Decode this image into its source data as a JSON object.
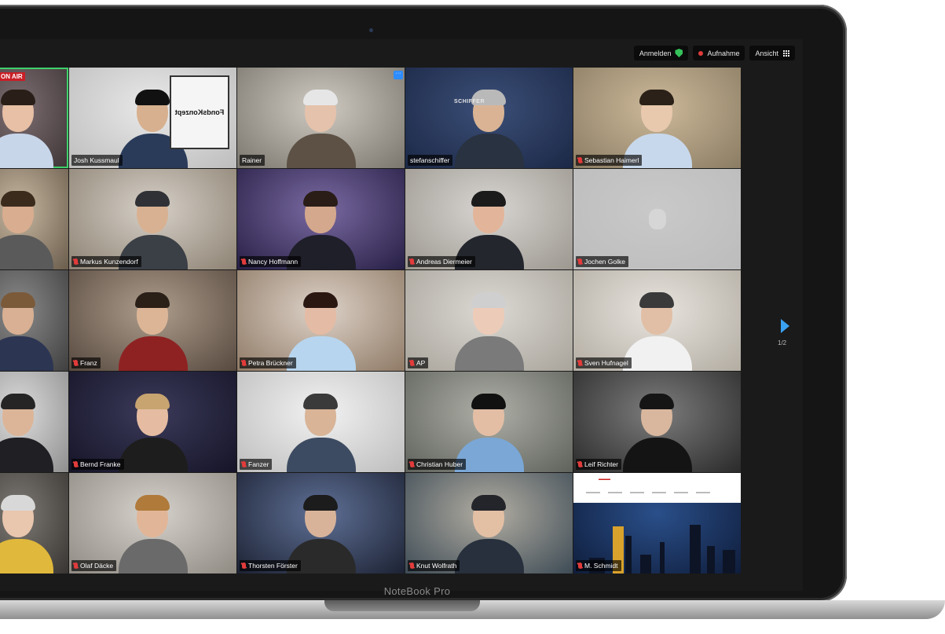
{
  "device": {
    "bezel_label": "NoteBook Pro"
  },
  "toolbar": {
    "signin_label": "Anmelden",
    "recording_label": "Aufnahme",
    "view_label": "Ansicht",
    "security_color": "#35c25a",
    "recording_color": "#e23b3b"
  },
  "pager": {
    "label": "1/2"
  },
  "badges": {
    "on_air": "ON AIR",
    "brand_fondskonzept": "FondsKonzept",
    "brand_schiffer": "SCHIFFER",
    "more": "···"
  },
  "participants": [
    {
      "name": "",
      "muted": false,
      "active": true
    },
    {
      "name": "Josh Kussmaul",
      "muted": false
    },
    {
      "name": "Rainer",
      "muted": false
    },
    {
      "name": "stefanschiffer",
      "muted": false
    },
    {
      "name": "Sebastian Haimerl",
      "muted": true
    },
    {
      "name": "",
      "muted": false
    },
    {
      "name": "Markus Kunzendorf",
      "muted": true
    },
    {
      "name": "Nancy Hoffmann",
      "muted": true
    },
    {
      "name": "Andreas Diermeier",
      "muted": true
    },
    {
      "name": "Jochen Golke",
      "muted": true
    },
    {
      "name": "",
      "muted": false
    },
    {
      "name": "Franz",
      "muted": true
    },
    {
      "name": "Petra Brückner",
      "muted": true
    },
    {
      "name": "AP",
      "muted": true
    },
    {
      "name": "Sven Hufnagel",
      "muted": true
    },
    {
      "name": "",
      "muted": false
    },
    {
      "name": "Bernd Franke",
      "muted": true
    },
    {
      "name": "Fanzer",
      "muted": true
    },
    {
      "name": "Christian Huber",
      "muted": true
    },
    {
      "name": "Leif Richter",
      "muted": true
    },
    {
      "name": "",
      "muted": false
    },
    {
      "name": "Olaf Däcke",
      "muted": true
    },
    {
      "name": "Thorsten Förster",
      "muted": true
    },
    {
      "name": "Knut Wolfrath",
      "muted": true
    },
    {
      "name": "M. Schmidt",
      "muted": true
    }
  ]
}
